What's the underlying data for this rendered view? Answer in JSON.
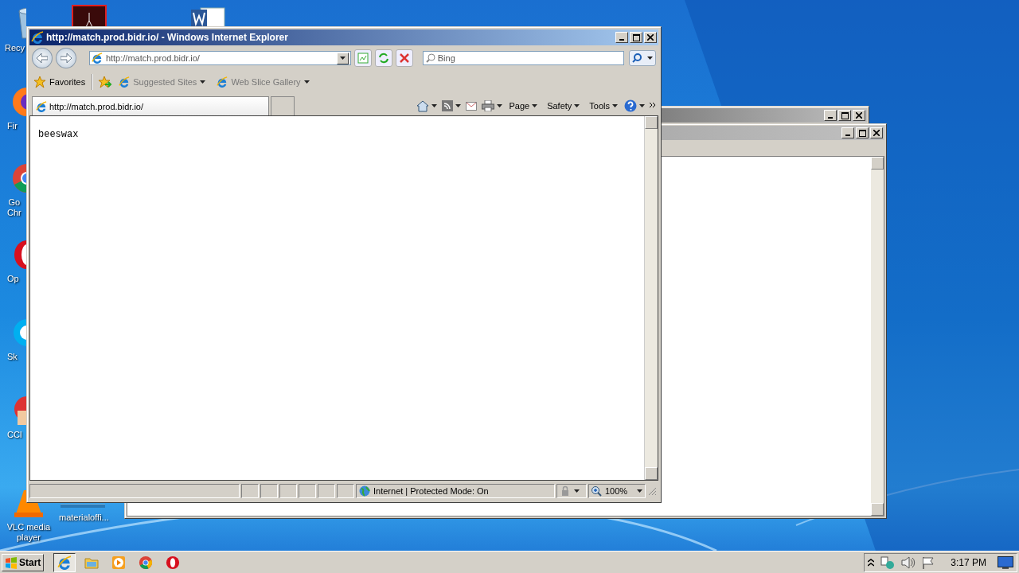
{
  "desktop_icons": [
    {
      "kind": "recycle",
      "lines": [
        "Recy"
      ]
    },
    {
      "kind": "pdf"
    },
    {
      "kind": "word"
    },
    {
      "kind": "firefox",
      "lines": [
        "Fir"
      ]
    },
    {
      "kind": "chrome",
      "lines": [
        "Go",
        "Chr"
      ]
    },
    {
      "kind": "opera",
      "lines": [
        "Op"
      ]
    },
    {
      "kind": "skype",
      "lines": [
        "Sk"
      ]
    },
    {
      "kind": "ccleaner",
      "lines": [
        "CCl"
      ]
    },
    {
      "kind": "vlc",
      "lines": [
        "VLC media",
        "player"
      ]
    },
    {
      "kind": "folder",
      "lines": [
        "materialoffi..."
      ]
    }
  ],
  "ie_window": {
    "title": "http://match.prod.bidr.io/ - Windows Internet Explorer",
    "address": "http://match.prod.bidr.io/",
    "search_placeholder": "Bing",
    "favorites_label": "Favorites",
    "favorites_links": [
      "Suggested Sites",
      "Web Slice Gallery"
    ],
    "tab": {
      "label": "http://match.prod.bidr.io/",
      "selected": true
    },
    "command_menus": [
      "Page",
      "Safety",
      "Tools"
    ],
    "page_text": "beeswax",
    "status": {
      "zone": "Internet | Protected Mode: On",
      "zoom": "100%"
    }
  },
  "taskbar": {
    "start_label": "Start",
    "pinned": [
      {
        "kind": "ie",
        "selected": true
      },
      {
        "kind": "explorer",
        "selected": false
      },
      {
        "kind": "media",
        "selected": false
      },
      {
        "kind": "chrome",
        "selected": false
      },
      {
        "kind": "opera",
        "selected": false
      }
    ],
    "clock": "3:17 PM"
  }
}
